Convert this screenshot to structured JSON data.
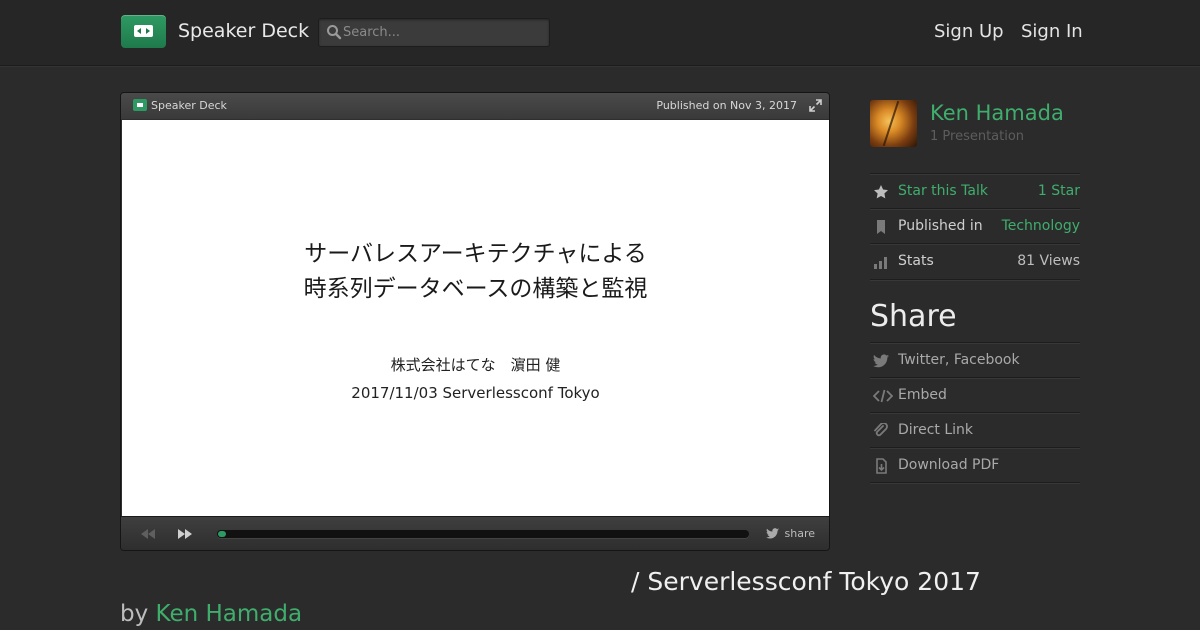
{
  "header": {
    "brand": "Speaker Deck",
    "search_placeholder": "Search...",
    "nav": [
      "Sign Up",
      "Sign In"
    ]
  },
  "player": {
    "brand": "Speaker Deck",
    "published": "Published on Nov 3, 2017",
    "slide": {
      "title_lines": [
        "サーバレスアーキテクチャによる",
        "時系列データベースの構築と監視"
      ],
      "subtitle_lines": [
        "株式会社はてな　濵田 健",
        "2017/11/03 Serverlessconf Tokyo"
      ]
    },
    "progress_fraction": 0.015,
    "share_label": "share"
  },
  "talk": {
    "title_fragment": "/ Serverlessconf Tokyo 2017",
    "by_prefix": "by ",
    "author": "Ken Hamada"
  },
  "sidebar": {
    "user_name": "Ken Hamada",
    "presentation_count": "1 Presentation",
    "stats": [
      {
        "icon": "star-icon",
        "label": "Star this Talk",
        "value": "1 Star"
      },
      {
        "icon": "bookmark-icon",
        "label": "Published in",
        "value": "Technology"
      },
      {
        "icon": "bar-chart-icon",
        "label": "Stats",
        "value": "81 Views"
      }
    ],
    "share_heading": "Share",
    "share_items": [
      {
        "icon": "twitter-bird-icon",
        "label": "Twitter, Facebook"
      },
      {
        "icon": "code-icon",
        "label": "Embed"
      },
      {
        "icon": "paperclip-icon",
        "label": "Direct Link"
      },
      {
        "icon": "download-icon",
        "label": "Download PDF"
      }
    ]
  },
  "colors": {
    "accent": "#3fae6d",
    "background": "#2b2b2b",
    "header": "#262626"
  }
}
